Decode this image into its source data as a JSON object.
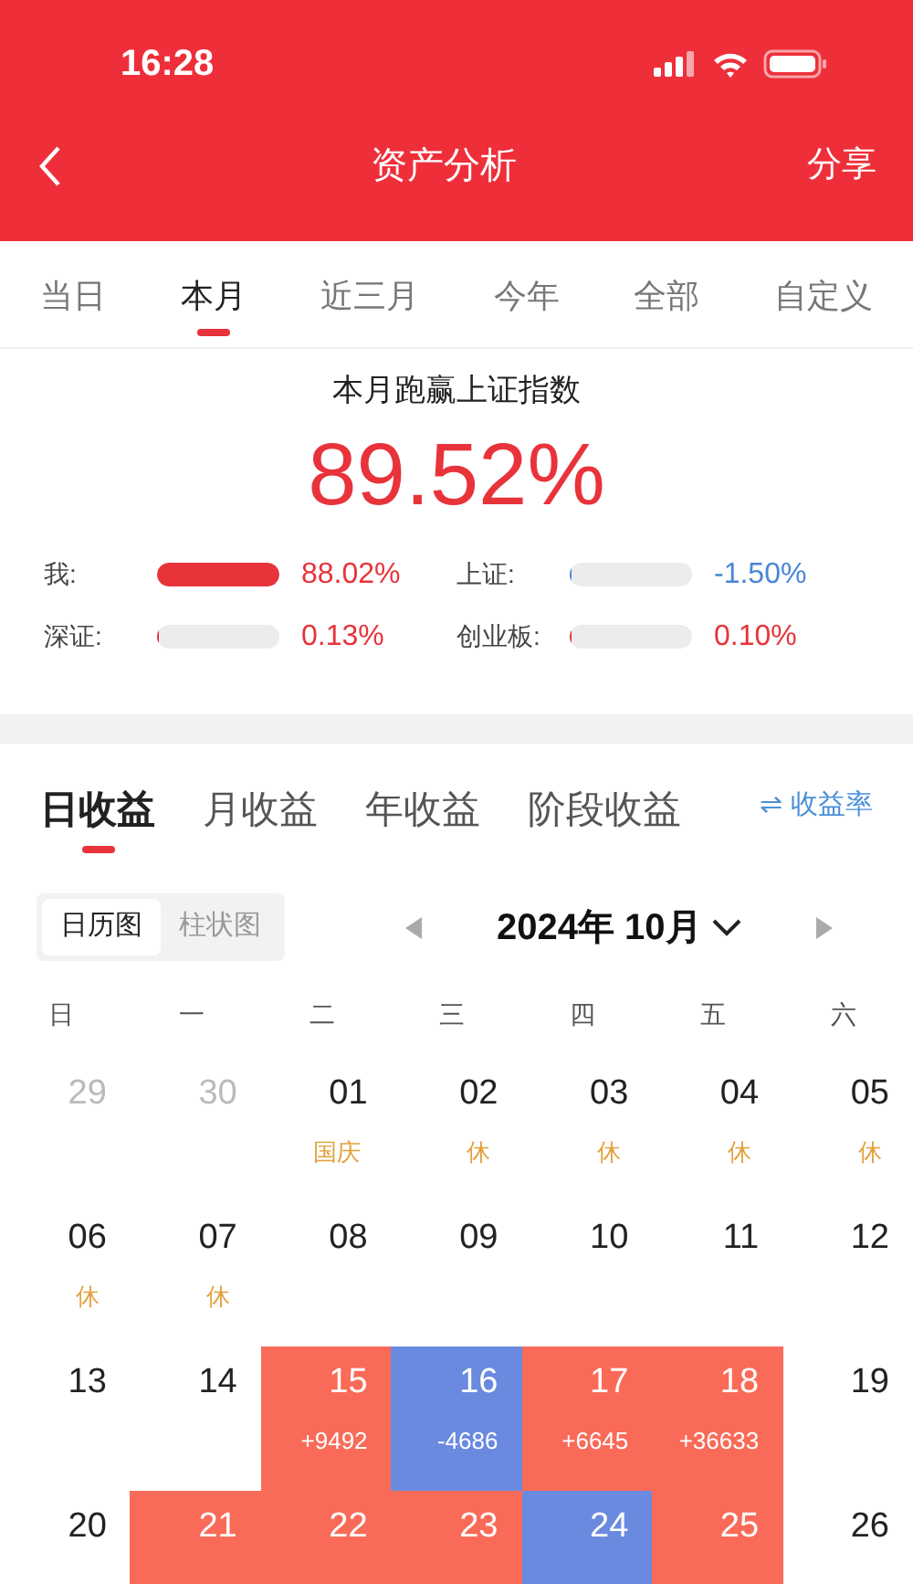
{
  "status_bar": {
    "time": "16:28"
  },
  "nav": {
    "title": "资产分析",
    "action": "分享"
  },
  "period_tabs": [
    {
      "label": "当日",
      "selected": false
    },
    {
      "label": "本月",
      "selected": true
    },
    {
      "label": "近三月",
      "selected": false
    },
    {
      "label": "今年",
      "selected": false
    },
    {
      "label": "全部",
      "selected": false
    },
    {
      "label": "自定义",
      "selected": false
    }
  ],
  "summary": {
    "title": "本月跑赢上证指数",
    "value": "89.52%"
  },
  "comparisons": [
    {
      "label": "我:",
      "level": 1,
      "reading": "88.02%",
      "color": "#e8333a"
    },
    {
      "label": "上证:",
      "level": 0.02,
      "reading": "-1.50%",
      "color": "#4a86d8"
    },
    {
      "label": "深证:",
      "level": 0.02,
      "reading": "0.13%",
      "color": "#e8333a"
    },
    {
      "label": "创业板:",
      "level": 0.02,
      "reading": "0.10%",
      "color": "#e8333a"
    }
  ],
  "earnings_tabs": [
    {
      "label": "日收益",
      "selected": true
    },
    {
      "label": "月收益",
      "selected": false
    },
    {
      "label": "年收益",
      "selected": false
    },
    {
      "label": "阶段收益",
      "selected": false
    }
  ],
  "toggle_link": "⇌ 收益率",
  "view_switch": [
    {
      "label": "日历图",
      "selected": true
    },
    {
      "label": "柱状图",
      "selected": false
    }
  ],
  "month": "2024年 10月",
  "weekdays": [
    "日",
    "一",
    "二",
    "三",
    "四",
    "五",
    "六"
  ],
  "days": [
    {
      "day": "29",
      "kind": "muted"
    },
    {
      "day": "30",
      "kind": "muted"
    },
    {
      "day": "01",
      "kind": "normal",
      "note": "国庆"
    },
    {
      "day": "02",
      "kind": "normal",
      "note": "休"
    },
    {
      "day": "03",
      "kind": "normal",
      "note": "休"
    },
    {
      "day": "04",
      "kind": "normal",
      "note": "休"
    },
    {
      "day": "05",
      "kind": "normal",
      "note": "休"
    },
    {
      "day": "06",
      "kind": "normal",
      "note": "休"
    },
    {
      "day": "07",
      "kind": "normal",
      "note": "休"
    },
    {
      "day": "08",
      "kind": "normal"
    },
    {
      "day": "09",
      "kind": "normal"
    },
    {
      "day": "10",
      "kind": "normal"
    },
    {
      "day": "11",
      "kind": "normal"
    },
    {
      "day": "12",
      "kind": "normal"
    },
    {
      "day": "13",
      "kind": "normal"
    },
    {
      "day": "14",
      "kind": "normal"
    },
    {
      "day": "15",
      "kind": "gain",
      "amount": "+9492"
    },
    {
      "day": "16",
      "kind": "loss",
      "amount": "-4686"
    },
    {
      "day": "17",
      "kind": "gain",
      "amount": "+6645"
    },
    {
      "day": "18",
      "kind": "gain",
      "amount": "+36633"
    },
    {
      "day": "19",
      "kind": "normal"
    },
    {
      "day": "20",
      "kind": "normal"
    },
    {
      "day": "21",
      "kind": "gain"
    },
    {
      "day": "22",
      "kind": "gain"
    },
    {
      "day": "23",
      "kind": "gain"
    },
    {
      "day": "24",
      "kind": "loss"
    },
    {
      "day": "25",
      "kind": "gain"
    },
    {
      "day": "26",
      "kind": "normal"
    }
  ]
}
